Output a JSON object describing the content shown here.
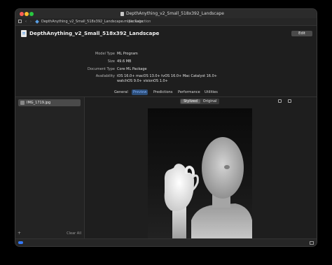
{
  "window": {
    "title": "DepthAnything_v2_Small_518x392_Landscape"
  },
  "pathbar": {
    "file": "DepthAnything_v2_Small_518x392_Landscape.mlpackage",
    "separator": "›",
    "selection": "No Selection"
  },
  "header": {
    "model_name": "DepthAnything_v2_Small_518x392_Landscape",
    "edit_label": "Edit",
    "properties": [
      {
        "label": "Model Type",
        "value": "ML Program"
      },
      {
        "label": "Size",
        "value": "49.6 MB"
      },
      {
        "label": "Document Type",
        "value": "Core ML Package"
      },
      {
        "label": "Availability",
        "value": "iOS 16.0+   macOS 13.0+   tvOS 16.0+   Mac Catalyst 16.0+"
      },
      {
        "label": "",
        "value": "watchOS 9.0+   visionOS 1.0+"
      }
    ]
  },
  "tabs": [
    {
      "label": "General",
      "active": false
    },
    {
      "label": "Preview",
      "active": true
    },
    {
      "label": "Predictions",
      "active": false
    },
    {
      "label": "Performance",
      "active": false
    },
    {
      "label": "Utilities",
      "active": false
    }
  ],
  "sidebar": {
    "items": [
      {
        "label": "IMG_1719.jpg",
        "selected": true
      }
    ],
    "add_label": "+",
    "clear_label": "Clear All"
  },
  "preview": {
    "segments": {
      "stylized": "Stylized",
      "original": "Original",
      "selected": "Stylized"
    },
    "tool_icons": [
      "export-icon",
      "open-external-icon"
    ]
  },
  "colors": {
    "accent": "#3478f6",
    "active_tab_bg": "#2d4f7a",
    "active_tab_text": "#7fb0ff",
    "window_bg": "#1e1e1e"
  }
}
